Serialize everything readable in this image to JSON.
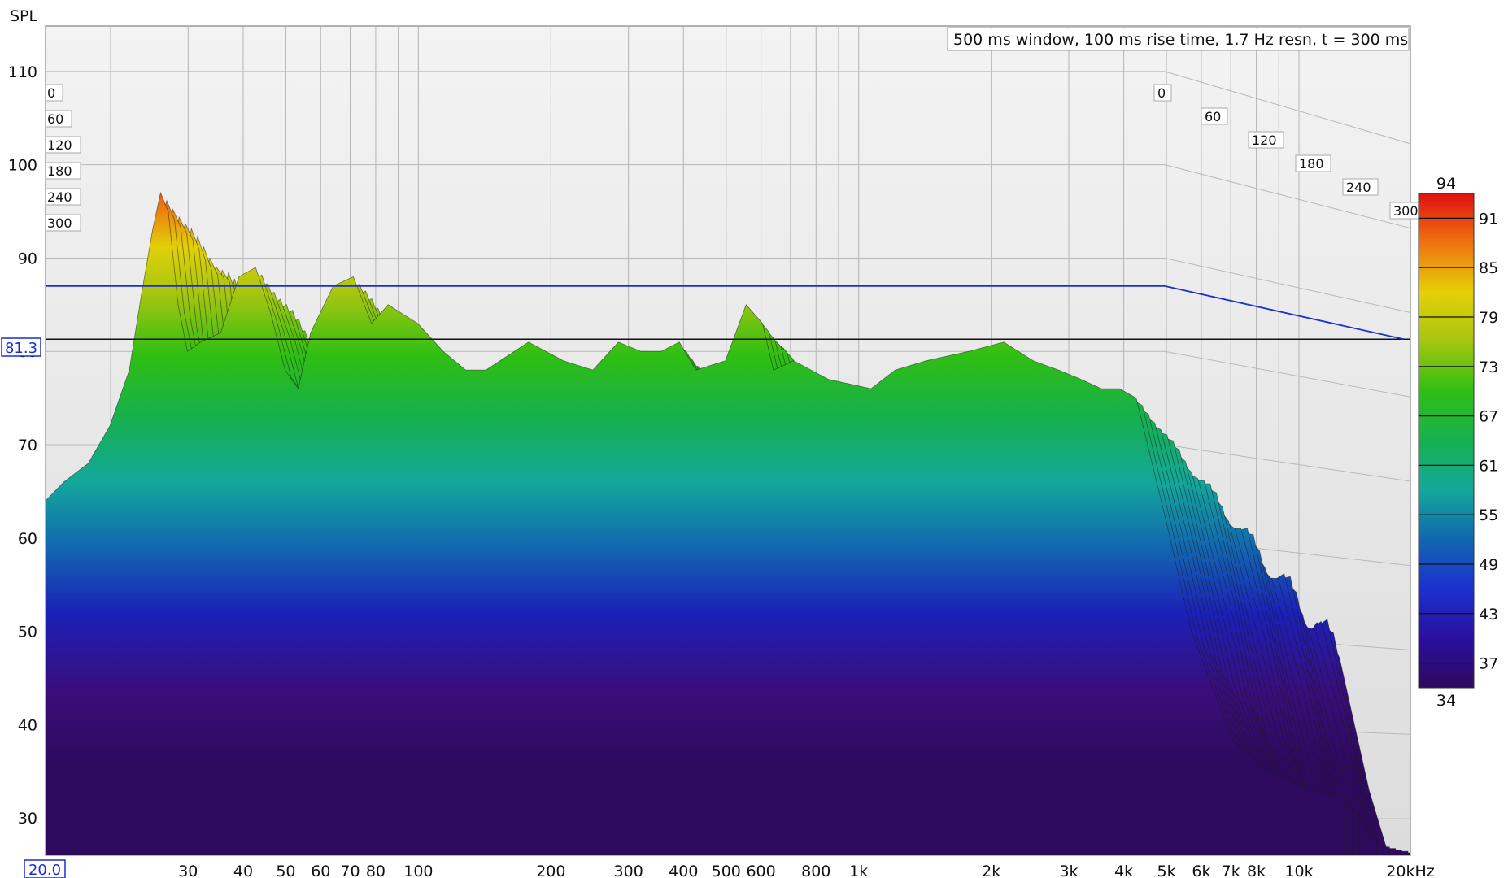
{
  "chart_data": {
    "type": "waterfall",
    "y_axis_label": "SPL",
    "x_unit_label": "20kHz",
    "annotation": "500 ms window, 100 ms rise time,  1.7 Hz resn, t = 300 ms",
    "marker_value": "81.3",
    "x_start_label": "20.0",
    "xlim": [
      20,
      20000
    ],
    "ylim": [
      26,
      114
    ],
    "x_scale": "log",
    "grid": true,
    "y_ticks": [
      30,
      40,
      50,
      60,
      70,
      80,
      90,
      100,
      110
    ],
    "x_tick_labels": [
      {
        "f": 30,
        "label": "30"
      },
      {
        "f": 40,
        "label": "40"
      },
      {
        "f": 50,
        "label": "50"
      },
      {
        "f": 60,
        "label": "60"
      },
      {
        "f": 70,
        "label": "70"
      },
      {
        "f": 80,
        "label": "80"
      },
      {
        "f": 100,
        "label": "100"
      },
      {
        "f": 200,
        "label": "200"
      },
      {
        "f": 300,
        "label": "300"
      },
      {
        "f": 400,
        "label": "400"
      },
      {
        "f": 500,
        "label": "500"
      },
      {
        "f": 600,
        "label": "600"
      },
      {
        "f": 800,
        "label": "800"
      },
      {
        "f": 1000,
        "label": "1k"
      },
      {
        "f": 2000,
        "label": "2k"
      },
      {
        "f": 3000,
        "label": "3k"
      },
      {
        "f": 4000,
        "label": "4k"
      },
      {
        "f": 5000,
        "label": "5k"
      },
      {
        "f": 6000,
        "label": "6k"
      },
      {
        "f": 7000,
        "label": "7k"
      },
      {
        "f": 8000,
        "label": "8k"
      },
      {
        "f": 10000,
        "label": "10k"
      }
    ],
    "time_ticks_ms": [
      "0",
      "60",
      "120",
      "180",
      "240",
      "300"
    ],
    "blue_line_spl": 87,
    "colorbar": {
      "min": "34",
      "max": "94",
      "ticks": [
        "91",
        "85",
        "79",
        "73",
        "67",
        "61",
        "55",
        "49",
        "43",
        "37"
      ]
    },
    "front_slice_t0": {
      "freq_hz": [
        20,
        22,
        25,
        28,
        31,
        33,
        35,
        36.5,
        38,
        40,
        42,
        45,
        50,
        55,
        60,
        65,
        70,
        75,
        80,
        90,
        100,
        110,
        120,
        140,
        160,
        180,
        200,
        250,
        300,
        350,
        400,
        450,
        500,
        550,
        600,
        700,
        780,
        850,
        900,
        1000,
        1200,
        1500,
        1700,
        2000,
        2500,
        3000,
        3500,
        4000,
        4500,
        5000,
        5500,
        6000,
        7000,
        8000,
        10000,
        12000,
        15000,
        18000
      ],
      "spl_db": [
        64,
        66,
        68,
        72,
        78,
        86,
        93,
        97,
        95,
        85,
        80,
        81,
        82,
        88,
        89,
        84,
        78,
        76,
        82,
        87,
        88,
        83,
        85,
        83,
        80,
        78,
        78,
        81,
        79,
        78,
        81,
        80,
        80,
        81,
        78,
        79,
        85,
        83,
        78,
        79,
        77,
        76,
        78,
        79,
        80,
        81,
        79,
        78,
        77,
        76,
        76,
        75,
        62,
        50,
        38,
        35,
        33,
        32
      ]
    }
  }
}
